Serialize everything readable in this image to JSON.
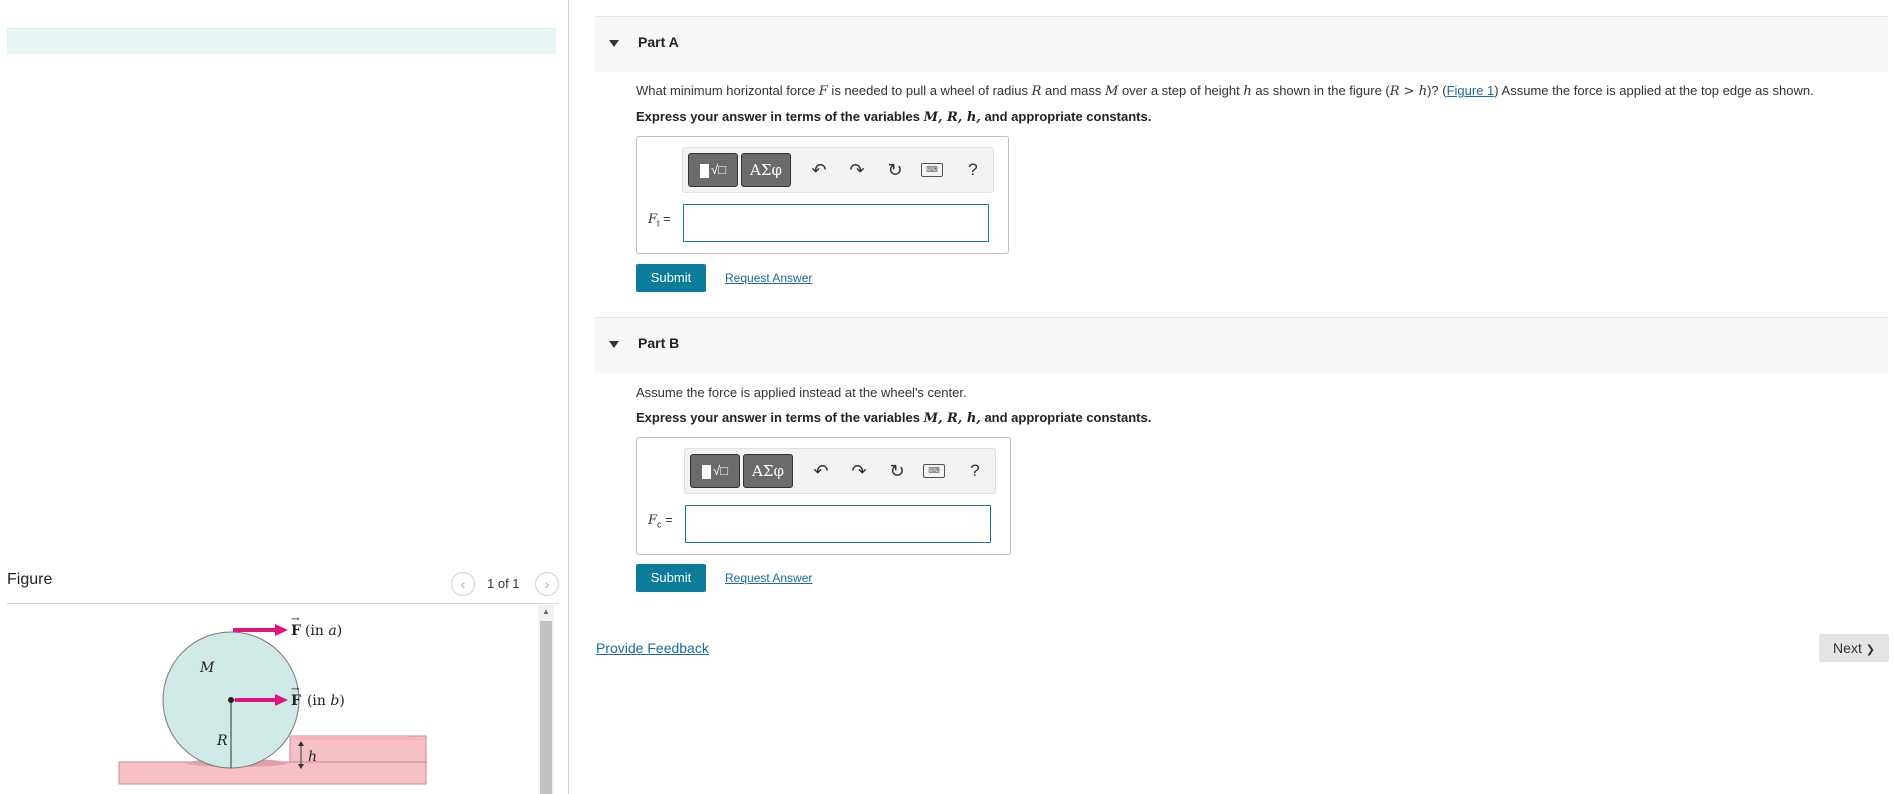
{
  "figure_panel": {
    "title": "Figure",
    "prev_icon": "chevron-left-icon",
    "next_icon": "chevron-right-icon",
    "prev_glyph": "‹",
    "next_glyph": "›",
    "counter": "1 of 1",
    "labels": {
      "force_a_vec": "F",
      "force_a_suffix": "(in ",
      "force_a_var": "a",
      "force_a_close": ")",
      "force_b_vec": "F",
      "force_b_suffix": "(in ",
      "force_b_var": "b",
      "force_b_close": ")",
      "mass": "M",
      "radius": "R",
      "height": "h"
    },
    "colors": {
      "wheel": "#cfe9e6",
      "step": "#f7c0c6",
      "arrow": "#e0147d"
    }
  },
  "part_a": {
    "title": "Part A",
    "question": {
      "t1": "What minimum horizontal force ",
      "v1": "F",
      "t2": " is needed to pull a wheel of radius ",
      "v2": "R",
      "t3": " and mass ",
      "v3": "M",
      "t4": " over a step of height ",
      "v4": "h",
      "t5": " as shown in the figure (",
      "v5": "R > h",
      "t6": ")? (",
      "link": "Figure 1",
      "t7": ") Assume the force is applied at the top edge as shown."
    },
    "instruction": {
      "t1": "Express your answer in terms of the variables ",
      "vars": "M, R, h,",
      "t2": " and appropriate constants."
    },
    "answer_label": "F",
    "answer_sub": "t",
    "answer_eq": " =",
    "answer_value": "",
    "submit": "Submit",
    "request": "Request Answer"
  },
  "part_b": {
    "title": "Part B",
    "question": "Assume the force is applied instead at the wheel's center.",
    "instruction": {
      "t1": "Express your answer in terms of the variables ",
      "vars": "M, R, h,",
      "t2": " and appropriate constants."
    },
    "answer_label": "F",
    "answer_sub": "c",
    "answer_eq": " =",
    "answer_value": "",
    "submit": "Submit",
    "request": "Request Answer"
  },
  "toolbar": {
    "template_label": "√□",
    "greek_label": "ΑΣφ",
    "undo": "↶",
    "redo": "↷",
    "reset": "↻",
    "keyboard": "⌨",
    "help": "?",
    "icons": [
      "templates-icon",
      "greek-symbols-icon",
      "undo-icon",
      "redo-icon",
      "reset-icon",
      "keyboard-icon",
      "help-icon"
    ]
  },
  "footer": {
    "feedback": "Provide Feedback",
    "next": "Next",
    "next_glyph": "❯"
  }
}
